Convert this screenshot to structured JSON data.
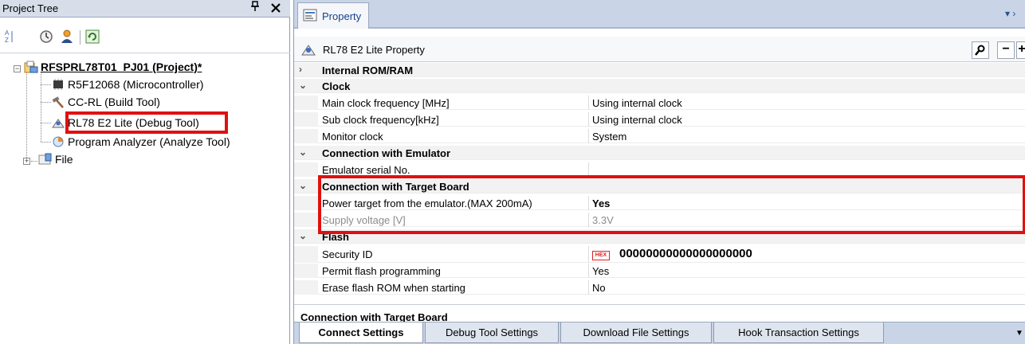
{
  "project_tree": {
    "title": "Project Tree",
    "pin_glyph": "⌥",
    "close_glyph": "✕",
    "project": "RFSPRL78T01_PJ01 (Project)*",
    "items": [
      "R5F12068 (Microcontroller)",
      "CC-RL (Build Tool)",
      "RL78 E2 Lite (Debug Tool)",
      "Program Analyzer (Analyze Tool)"
    ],
    "file_folder": "File"
  },
  "property": {
    "tab_label": "Property",
    "header": "RL78 E2 Lite Property",
    "categories": [
      {
        "name": "Internal ROM/RAM",
        "chevron": ">",
        "rows": []
      },
      {
        "name": "Clock",
        "chevron": "v",
        "rows": [
          {
            "name": "Main clock frequency [MHz]",
            "value": "Using internal clock"
          },
          {
            "name": "Sub clock frequency[kHz]",
            "value": "Using internal clock"
          },
          {
            "name": "Monitor clock",
            "value": "System"
          }
        ]
      },
      {
        "name": "Connection with Emulator",
        "chevron": "v",
        "rows": [
          {
            "name": "Emulator serial No.",
            "value": ""
          }
        ]
      },
      {
        "name": "Connection with Target Board",
        "chevron": "v",
        "rows": [
          {
            "name": "Power target from the emulator.(MAX 200mA)",
            "value": "Yes"
          },
          {
            "name": "Supply voltage [V]",
            "value": "3.3V"
          }
        ]
      },
      {
        "name": "Flash",
        "chevron": "v",
        "rows": [
          {
            "name": "Security ID",
            "value": "00000000000000000000"
          },
          {
            "name": "Permit flash programming",
            "value": "Yes"
          },
          {
            "name": "Erase flash ROM when starting",
            "value": "No"
          }
        ]
      }
    ],
    "hex_badge": "HEX",
    "description_title": "Connection with Target Board",
    "bottom_tabs": [
      "Connect Settings",
      "Debug Tool Settings",
      "Download File Settings",
      "Hook Transaction Settings"
    ]
  },
  "colors": {
    "highlight_box": "#e01010",
    "panel_header": "#c9d4e6"
  }
}
